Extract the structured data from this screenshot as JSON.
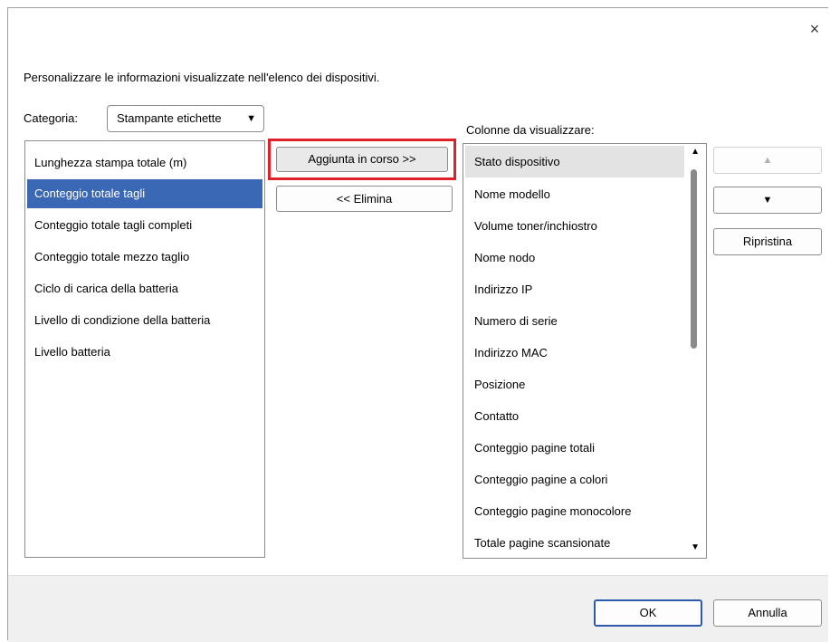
{
  "dialog": {
    "close_symbol": "×",
    "instruction": "Personalizzare le informazioni visualizzate nell'elenco dei dispositivi."
  },
  "category": {
    "label": "Categoria:",
    "selected": "Stampante etichette"
  },
  "available": {
    "items": [
      "Lunghezza stampa totale (m)",
      "Conteggio totale tagli",
      "Conteggio totale tagli completi",
      "Conteggio totale mezzo taglio",
      "Ciclo di carica della batteria",
      "Livello di condizione della batteria",
      "Livello batteria"
    ],
    "selected_index": 1
  },
  "buttons": {
    "add": "Aggiunta in corso >>",
    "remove": "<< Elimina",
    "reset": "Ripristina",
    "ok": "OK",
    "cancel": "Annulla"
  },
  "columns": {
    "label": "Colonne da visualizzare:",
    "items": [
      "Stato dispositivo",
      "Nome modello",
      "Volume toner/inchiostro",
      "Nome nodo",
      "Indirizzo IP",
      "Numero di serie",
      "Indirizzo MAC",
      "Posizione",
      "Contatto",
      "Conteggio pagine totali",
      "Conteggio pagine a colori",
      "Conteggio pagine monocolore",
      "Totale pagine scansionate"
    ],
    "selected_index": 0
  },
  "colors": {
    "selection": "#3a68b4",
    "highlight_border": "#e0202a"
  }
}
